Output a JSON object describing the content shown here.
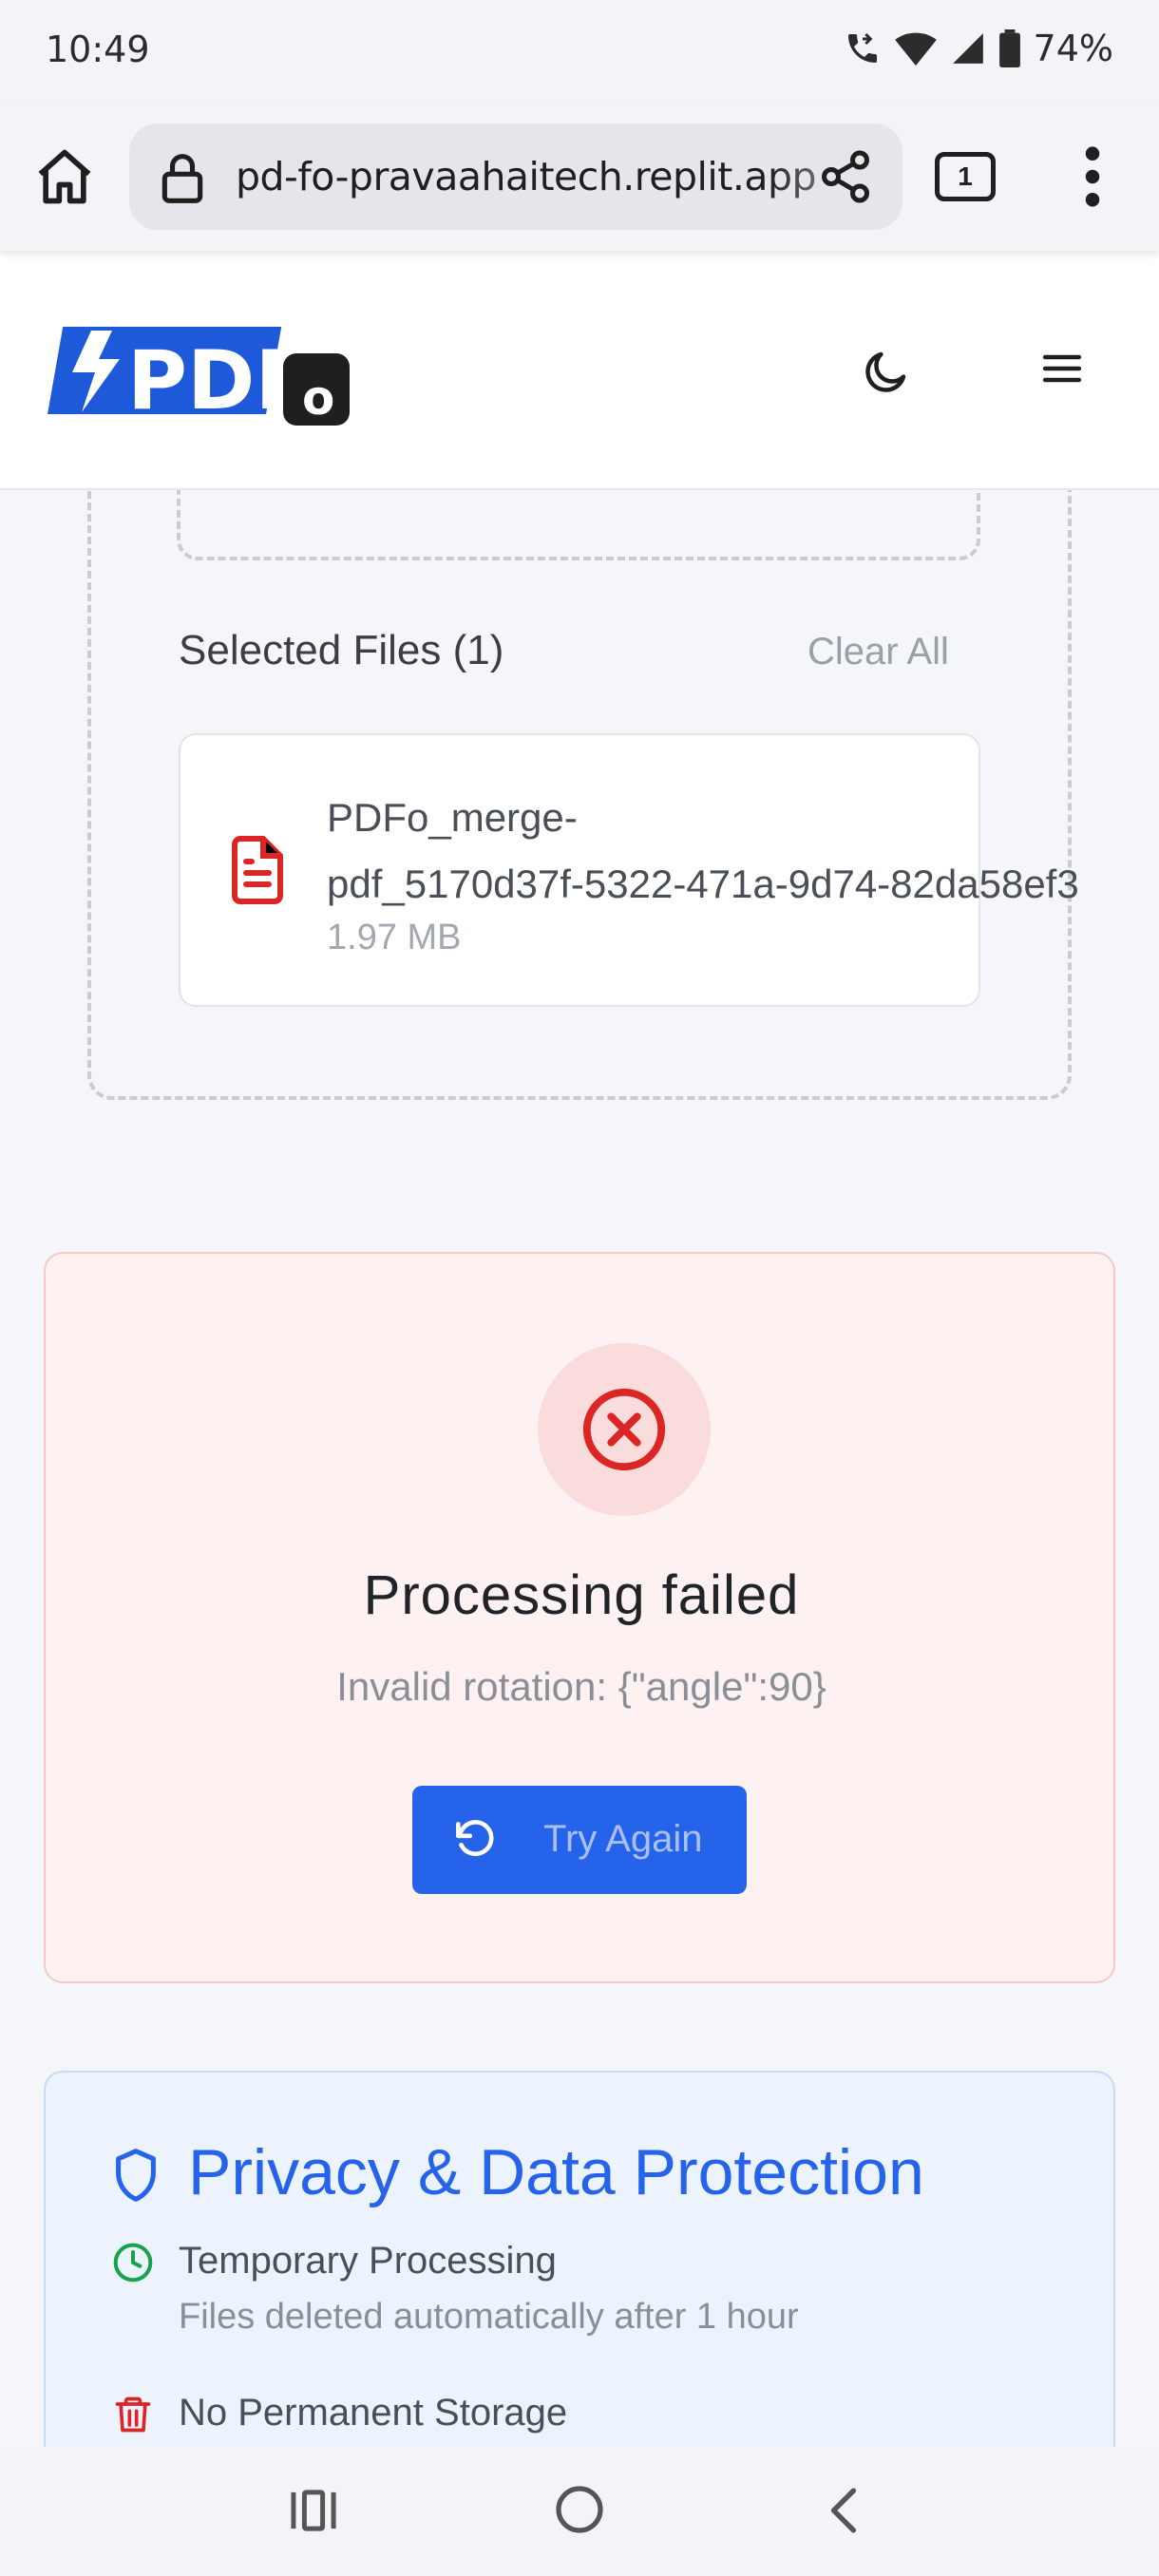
{
  "status_bar": {
    "time": "10:49",
    "battery": "74%",
    "icons": [
      "wifi-calling-icon",
      "wifi-icon",
      "signal-icon",
      "battery-icon"
    ]
  },
  "browser": {
    "url": "pd-fo-pravaahaitech.replit.app",
    "tab_count": "1",
    "icons": [
      "home-icon",
      "lock-icon",
      "share-icon",
      "more-vert-icon"
    ]
  },
  "header": {
    "logo_text": "PDF",
    "logo_badge": "o",
    "icons": [
      "moon-icon",
      "hamburger-icon"
    ]
  },
  "upload": {
    "selected_title": "Selected Files (1)",
    "clear_all": "Clear All",
    "files": [
      {
        "name_line1": "PDFo_merge-",
        "name_line2": "pdf_5170d37f-5322-471a-9d74-82da58ef3",
        "size": "1.97 MB",
        "icon": "file-text-icon"
      }
    ]
  },
  "error": {
    "title": "Processing failed",
    "message": "Invalid rotation: {\"angle\":90}",
    "button": "Try Again",
    "icon": "x-circle-icon",
    "button_icon": "rotate-ccw-icon"
  },
  "privacy": {
    "title": "Privacy & Data Protection",
    "icon": "shield-icon",
    "features": [
      {
        "title": "Temporary Processing",
        "desc": "Files deleted automatically after 1 hour",
        "icon": "clock-icon"
      },
      {
        "title": "No Permanent Storage",
        "desc": "",
        "icon": "trash-icon"
      }
    ]
  },
  "nav": {
    "icons": [
      "recents-icon",
      "home-circle-icon",
      "back-icon"
    ]
  },
  "colors": {
    "primary": "#2563eb",
    "error": "#dc2626",
    "success": "#16a34a",
    "error_bg": "#fdf1f1",
    "privacy_bg": "#ecf3fc"
  }
}
